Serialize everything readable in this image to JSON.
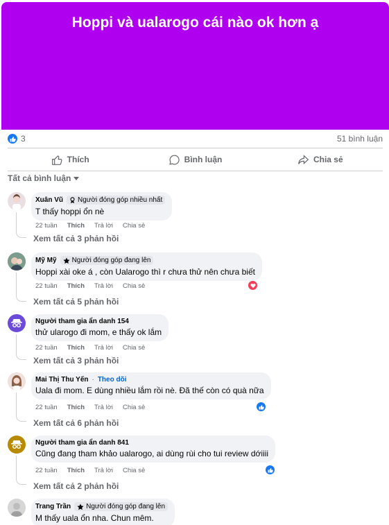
{
  "post": {
    "title": "Hoppi và ualarogo cái nào ok hơn ạ",
    "banner_color": "#b000f0",
    "reaction_count": "3",
    "comment_count": "51 bình luận"
  },
  "actions": {
    "like": "Thích",
    "comment": "Bình luận",
    "share": "Chia sẻ"
  },
  "filter_label": "Tất cả bình luận",
  "comments": [
    {
      "name": "Xuân Vũ",
      "badge": "Người đóng góp nhiều nhất",
      "badge_icon": "medal-icon",
      "text": "T thấy hoppi ổn nè",
      "time": "22 tuần",
      "like": "Thích",
      "reply": "Trả lời",
      "share": "Chia sẻ",
      "replies": "Xem tất cả 3 phản hồi",
      "reaction": ""
    },
    {
      "name": "Mỹ Mỹ",
      "badge": "Người đóng góp đang lên",
      "badge_icon": "star-icon",
      "text": "Hoppi xài oke á , còn Ualarogo thì r chưa thử nên chưa biết",
      "time": "22 tuần",
      "like": "Thích",
      "reply": "Trả lời",
      "share": "Chia sẻ",
      "replies": "Xem tất cả 5 phản hồi",
      "reaction": "love"
    },
    {
      "name": "Người tham gia ẩn danh 154",
      "text": "thử ularogo đi mom, e thấy ok lắm",
      "time": "22 tuần",
      "like": "Thích",
      "reply": "Trả lời",
      "share": "Chia sẻ",
      "replies": "Xem tất cả 3 phản hồi",
      "reaction": ""
    },
    {
      "name": "Mai Thị Thu Yến",
      "follow": "Theo dõi",
      "text": "Uala đi mom. E dùng nhiều lắm rồi nè. Đã thế còn có quà nữa",
      "time": "22 tuần",
      "like": "Thích",
      "reply": "Trả lời",
      "share": "Chia sẻ",
      "replies": "Xem tất cả 6 phản hồi",
      "reaction": "like"
    },
    {
      "name": "Người tham gia ẩn danh 841",
      "text": "Cũng đang tham khảo ualarogo, ai dùng rùi cho tui review dớiiii",
      "time": "22 tuần",
      "like": "Thích",
      "reply": "Trả lời",
      "share": "Chia sẻ",
      "replies": "Xem tất cả 2 phản hồi",
      "reaction": "like"
    },
    {
      "name": "Trang Trần",
      "badge": "Người đóng góp đang lên",
      "badge_icon": "star-icon",
      "text": "M thấy uala ổn nha. Chun mêm.",
      "reaction": ""
    }
  ],
  "colors": {
    "like_blue": "#1877f2",
    "love_red": "#f33e58",
    "anon_purple": "#6b4bd8",
    "anon_olive": "#b88a00",
    "link_blue": "#0064d1"
  }
}
